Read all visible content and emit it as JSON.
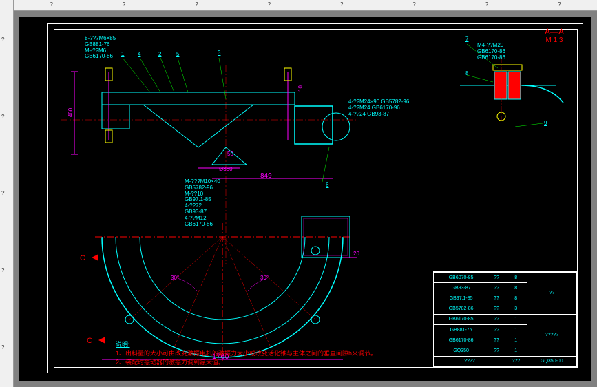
{
  "rulers": {
    "h_marks": [
      "?",
      "?",
      "?",
      "?",
      "?",
      "?",
      "?",
      "?"
    ],
    "v_marks": [
      "?",
      "?",
      "?",
      "?",
      "?",
      "?"
    ]
  },
  "grid_letters": {
    "top": [
      "?",
      "?",
      "?",
      "?"
    ],
    "bottom": [
      "?",
      "?",
      "?"
    ],
    "left": [
      "?",
      "?",
      "?"
    ],
    "right": [
      "?",
      "?"
    ]
  },
  "section": {
    "label": "A—A",
    "scale": "M 1:3"
  },
  "dimensions": {
    "h460": "460",
    "d350": "Ø350",
    "l849": "849",
    "l1760": "1760",
    "t50": "50",
    "t20": "20",
    "t10": "10",
    "a30_1": "30°",
    "a30_2": "30°"
  },
  "section_arrows": {
    "c1": "C",
    "c2": "C"
  },
  "callouts": {
    "c1": "1",
    "c2": "2",
    "c3": "3",
    "c4": "4",
    "c5": "5",
    "c6": "6",
    "c7": "7",
    "c8": "8",
    "c9": "9"
  },
  "specs": {
    "top_left": [
      "8-???M6×85",
      "GB881-76",
      "M–??M6",
      "GB6170-86"
    ],
    "mid_right": [
      "4-??M24×90 GB5782-96",
      "4-??M24 GB6170-96",
      "4-??24 GB93-87"
    ],
    "detail_top": [
      "M4-??M20",
      "GB6170-86",
      "GB6170-86"
    ],
    "mid_bottom": [
      "M-???M10×40",
      "GB5782-96",
      "M-??10",
      "GB97.1-85",
      "4-??72",
      "GB93-87",
      "4-??M12",
      "GB6170-86"
    ]
  },
  "notes": {
    "title": "说明:",
    "line1": "1、出料量的大小可由改变激振电机的激振力大小或改变活化锥与主体之间的垂直间隙h来调节。",
    "line2": "2、装配时振动器的激振力调到最大值。"
  },
  "title_block": {
    "rows": [
      [
        "GB6070-85",
        "??",
        "8"
      ],
      [
        "GB93-87",
        "??",
        "8"
      ],
      [
        "GB97.1-85",
        "??",
        "8"
      ],
      [
        "GB5782-86",
        "??",
        "3"
      ],
      [
        "GB6170-85",
        "??",
        "1"
      ],
      [
        "GB881-76",
        "??",
        "1"
      ],
      [
        "GB6170-86",
        "??",
        "1"
      ],
      [
        "GQ350",
        "??",
        "1"
      ]
    ],
    "header": [
      "",
      "",
      ""
    ],
    "project_name": "??",
    "drawing_title": "?????",
    "drawing_no": "GQ350-00",
    "scale_cell": "????",
    "sheet": "???"
  }
}
